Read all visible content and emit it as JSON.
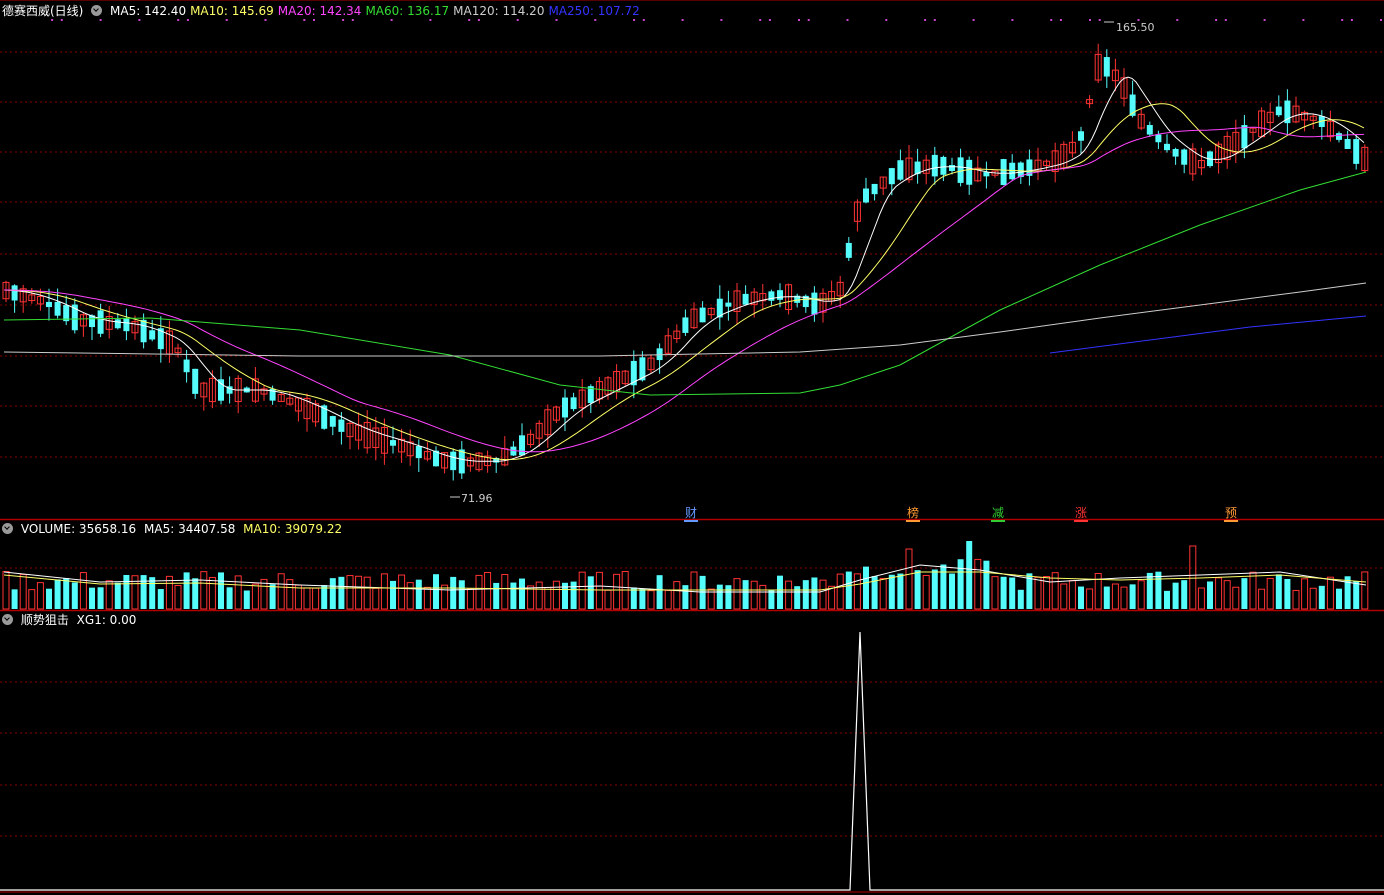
{
  "main_panel": {
    "title": "德赛西威(日线)",
    "ma": [
      {
        "label": "MA5: 142.40",
        "color": "#ffffff"
      },
      {
        "label": "MA10: 145.69",
        "color": "#ffff66"
      },
      {
        "label": "MA20: 142.34",
        "color": "#ff44ff"
      },
      {
        "label": "MA60: 136.17",
        "color": "#33dd33"
      },
      {
        "label": "MA120: 114.20",
        "color": "#cccccc"
      },
      {
        "label": "MA250: 107.72",
        "color": "#3333ff"
      }
    ],
    "high_label": "165.50",
    "low_label": "71.96",
    "events": [
      {
        "label": "财",
        "color": "#6699ff"
      },
      {
        "label": "榜",
        "color": "#ff9933"
      },
      {
        "label": "减",
        "color": "#33cc33"
      },
      {
        "label": "涨",
        "color": "#ff3333"
      },
      {
        "label": "预",
        "color": "#ff9933"
      }
    ]
  },
  "volume_panel": {
    "title": "VOLUME: 35658.16",
    "ma5": "MA5: 34407.58",
    "ma10": "MA10: 39079.22"
  },
  "indicator_panel": {
    "title": "顺势狙击",
    "xg1": "XG1: 0.00"
  },
  "colors": {
    "up": "#ff3333",
    "down": "#54fcfc",
    "grid": "#8b0000",
    "border": "#b00000"
  },
  "chart_data": {
    "type": "candlestick",
    "high": 165.5,
    "low": 71.96,
    "ma_values": {
      "MA5": 142.4,
      "MA10": 145.69,
      "MA20": 142.34,
      "MA60": 136.17,
      "MA120": 114.2,
      "MA250": 107.72
    },
    "volume": {
      "VOLUME": 35658.16,
      "MA5": 34407.58,
      "MA10": 39079.22
    },
    "indicator": {
      "XG1": 0.0
    }
  }
}
